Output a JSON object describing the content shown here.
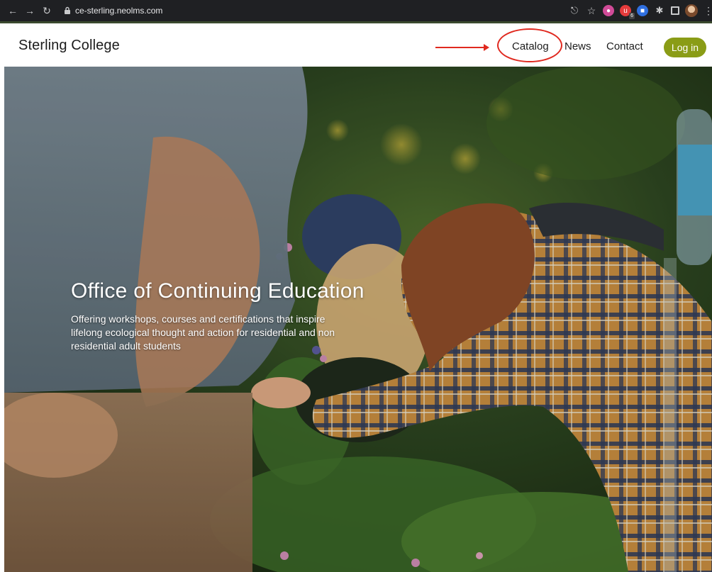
{
  "browser": {
    "url": "ce-sterling.neolms.com",
    "extension_badge": "6",
    "icons": [
      "back-icon",
      "forward-icon",
      "reload-icon",
      "lock-icon",
      "share-icon",
      "star-icon",
      "extension-icon",
      "puzzle-icon",
      "side-panel-icon",
      "profile-avatar",
      "menu-kebab-icon"
    ]
  },
  "header": {
    "brand": "Sterling College",
    "nav": {
      "catalog": "Catalog",
      "news": "News",
      "contact": "Contact"
    },
    "login_label": "Log in",
    "accent_color": "#8a9c16"
  },
  "hero": {
    "title": "Office of Continuing Education",
    "subtitle": "Offering workshops, courses and certifications that inspire lifelong ecological thought and action for residential and non residential adult students"
  },
  "annotation": {
    "color": "#e0291f"
  }
}
